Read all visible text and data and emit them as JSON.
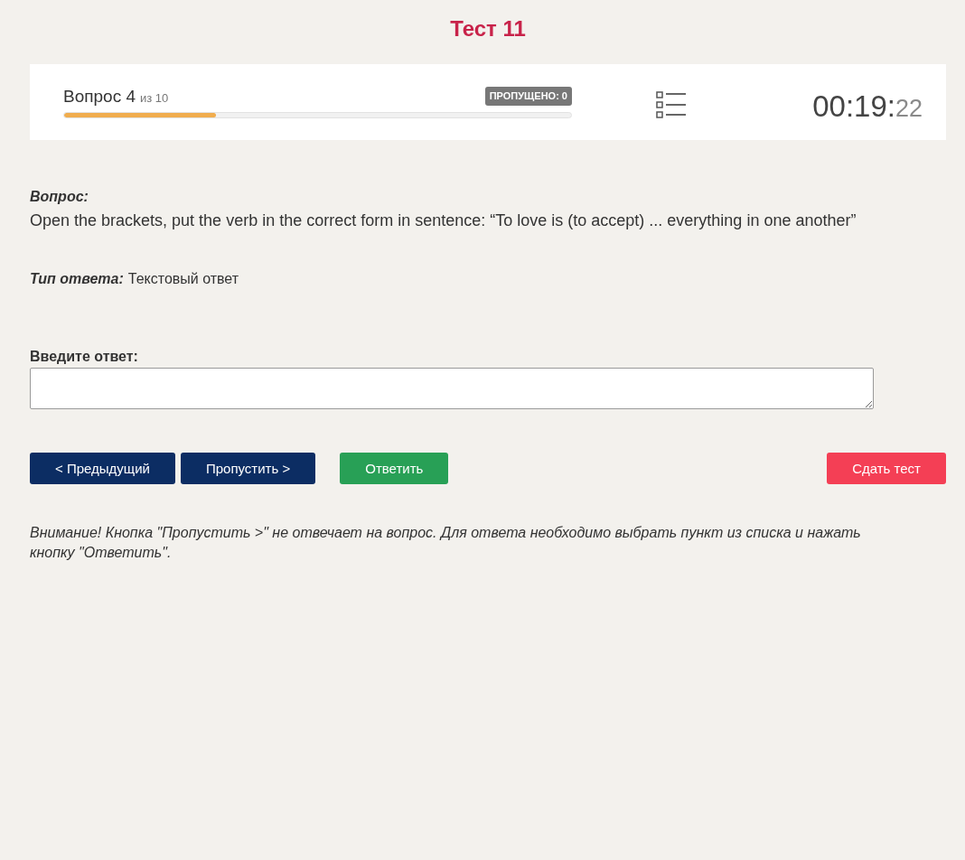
{
  "title": "Тест 11",
  "progress": {
    "question": "Вопрос 4",
    "of_total": "из 10",
    "skipped_badge": "ПРОПУЩЕНО: 0",
    "level": 0.3
  },
  "timer": {
    "main": "00:19:",
    "seconds": "22"
  },
  "question": {
    "label": "Вопрос:",
    "text": "Open the brackets, put the verb in the correct form in sentence: “To love is (to accept) ... everything in one another”"
  },
  "answer_type": {
    "label": "Тип ответа:",
    "value": "Текстовый ответ"
  },
  "answer_field": {
    "label": "Введите ответ:"
  },
  "buttons": [
    {
      "label": "< Предыдущий",
      "kind": "nav"
    },
    {
      "label": "Пропустить >",
      "kind": "nav"
    },
    {
      "label": "Ответить",
      "kind": "submit"
    },
    {
      "label": "Сдать тест",
      "kind": "finish"
    }
  ],
  "notice": "Внимание! Кнопка \"Пропустить >\" не отвечает на вопрос. Для ответа необходимо выбрать пункт из списка и нажать кнопку \"Ответить\"."
}
